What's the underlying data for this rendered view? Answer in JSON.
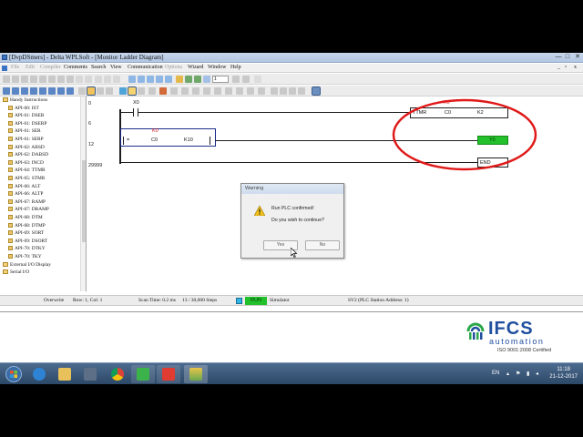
{
  "window": {
    "title": "[DvpDSmers] - Delta WPLSoft - [Monitor Ladder Diagram]",
    "controls": [
      "—",
      "□",
      "✕"
    ]
  },
  "menu": {
    "items": [
      {
        "label": "File",
        "dim": true
      },
      {
        "label": "Edit",
        "dim": true
      },
      {
        "label": "Compiler",
        "dim": true
      },
      {
        "label": "Comments",
        "dim": false
      },
      {
        "label": "Search",
        "dim": false
      },
      {
        "label": "View",
        "dim": false
      },
      {
        "label": "Communication",
        "dim": false
      },
      {
        "label": "Options",
        "dim": true
      },
      {
        "label": "Wizard",
        "dim": false
      },
      {
        "label": "Window",
        "dim": false
      },
      {
        "label": "Help",
        "dim": false
      }
    ]
  },
  "toolbar": {
    "zoom_value": "1"
  },
  "tree": {
    "items": [
      {
        "label": "Handy Instructions",
        "folder": true
      },
      {
        "label": "API-60: IST"
      },
      {
        "label": "API-61: DSER"
      },
      {
        "label": "API-61: DSERP"
      },
      {
        "label": "API-61: SER"
      },
      {
        "label": "API-61: SERP"
      },
      {
        "label": "API-62: ABSD"
      },
      {
        "label": "API-62: DABSD"
      },
      {
        "label": "API-63: INCD"
      },
      {
        "label": "API-64: TTMR"
      },
      {
        "label": "API-65: STMR"
      },
      {
        "label": "API-66: ALT"
      },
      {
        "label": "API-66: ALTP"
      },
      {
        "label": "API-67: RAMP"
      },
      {
        "label": "API-67: DRAMP"
      },
      {
        "label": "API-68: DTM"
      },
      {
        "label": "API-68: DTMP"
      },
      {
        "label": "API-69: SORT"
      },
      {
        "label": "API-69: DSORT"
      },
      {
        "label": "API-70: DTKY"
      },
      {
        "label": "API-70: TKY"
      },
      {
        "label": "External I/O Display",
        "folder": true
      },
      {
        "label": "Serial I/O",
        "folder": true
      }
    ]
  },
  "ladder": {
    "steps": [
      "0",
      "6",
      "12",
      "29999"
    ],
    "rung1_contact": "X0",
    "rung1_const": "K0",
    "ttmr": {
      "op": "TTMR",
      "a": "C0",
      "b": "K2",
      "k": "K0"
    },
    "rung2_contact": "=",
    "rung2_a": "C0",
    "rung2_b": "K10",
    "rung2_k": "K0",
    "coil": "Y0",
    "end": "END"
  },
  "dialog": {
    "title": "Warning",
    "line1": "Run PLC confirmed!",
    "line2": "Do you wish to continue?",
    "yes": "Yes",
    "no": "No"
  },
  "status": {
    "mode": "Overwrite",
    "rowcol": "Row: 1, Col: 1",
    "scan": "Scan Time: 0.2 ms",
    "steps": "13 / 30,000 Steps",
    "run": "RUN",
    "sim": "Simulator",
    "station": "SV2 (PLC Station Address: 1)"
  },
  "logo": {
    "brand": "IFCS",
    "sub": "automation",
    "cert": "ISO 9001:2008 Certified"
  },
  "taskbar": {
    "time": "11:18",
    "date": "21-12-2017",
    "lang": "EN"
  },
  "colors": {
    "run_green": "#22c02a",
    "annotation_red": "#e01a1a",
    "brand_blue": "#1f4f9e"
  }
}
